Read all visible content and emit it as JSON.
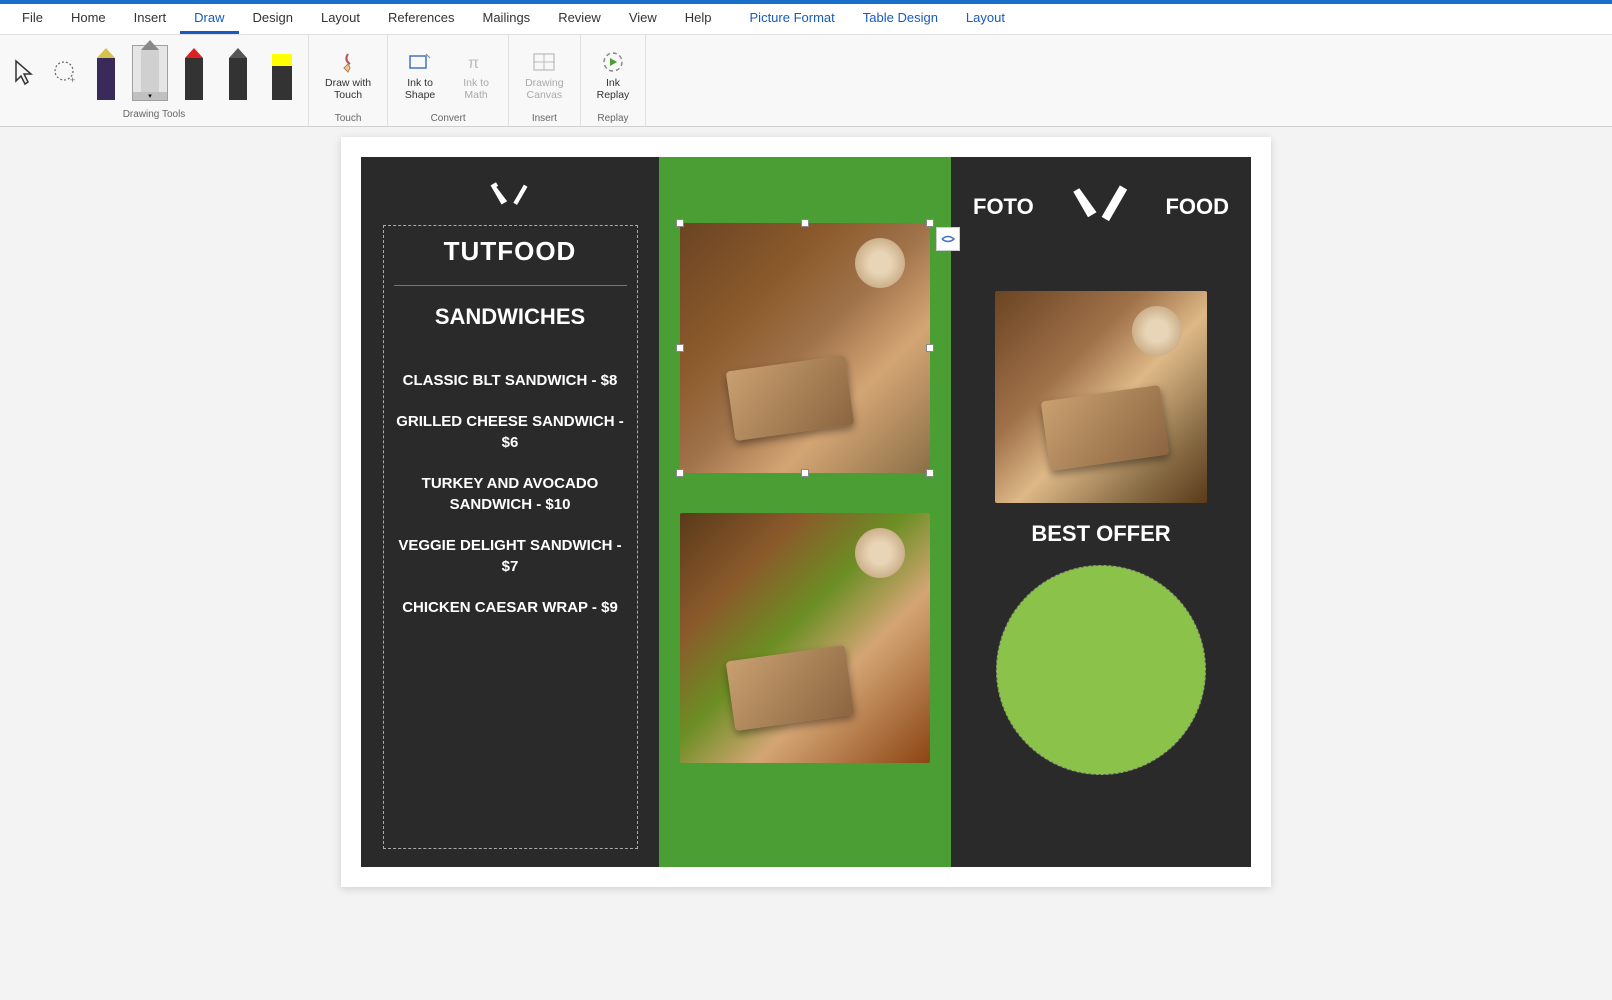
{
  "ribbon": {
    "tabs": [
      "File",
      "Home",
      "Insert",
      "Draw",
      "Design",
      "Layout",
      "References",
      "Mailings",
      "Review",
      "View",
      "Help",
      "Picture Format",
      "Table Design",
      "Layout"
    ],
    "active_tab": "Draw",
    "groups": {
      "drawing_tools": "Drawing Tools",
      "touch": "Touch",
      "convert": "Convert",
      "insert": "Insert",
      "replay": "Replay"
    },
    "buttons": {
      "draw_touch": "Draw with\nTouch",
      "ink_shape": "Ink to\nShape",
      "ink_math": "Ink to\nMath",
      "drawing_canvas": "Drawing\nCanvas",
      "ink_replay": "Ink\nReplay"
    },
    "pen_colors": [
      "#d6c24a",
      "#888888",
      "#e02020",
      "#555555",
      "#ffff00"
    ]
  },
  "document": {
    "left": {
      "title": "TUTFOOD",
      "section": "SANDWICHES",
      "items": [
        "CLASSIC BLT SANDWICH - $8",
        "GRILLED CHEESE SANDWICH - $6",
        "TURKEY AND AVOCADO SANDWICH - $10",
        "VEGGIE DELIGHT SANDWICH - $7",
        "CHICKEN CAESAR WRAP - $9"
      ]
    },
    "right": {
      "foto": "FOTO",
      "food": "FOOD",
      "best_offer": "BEST OFFER"
    }
  }
}
